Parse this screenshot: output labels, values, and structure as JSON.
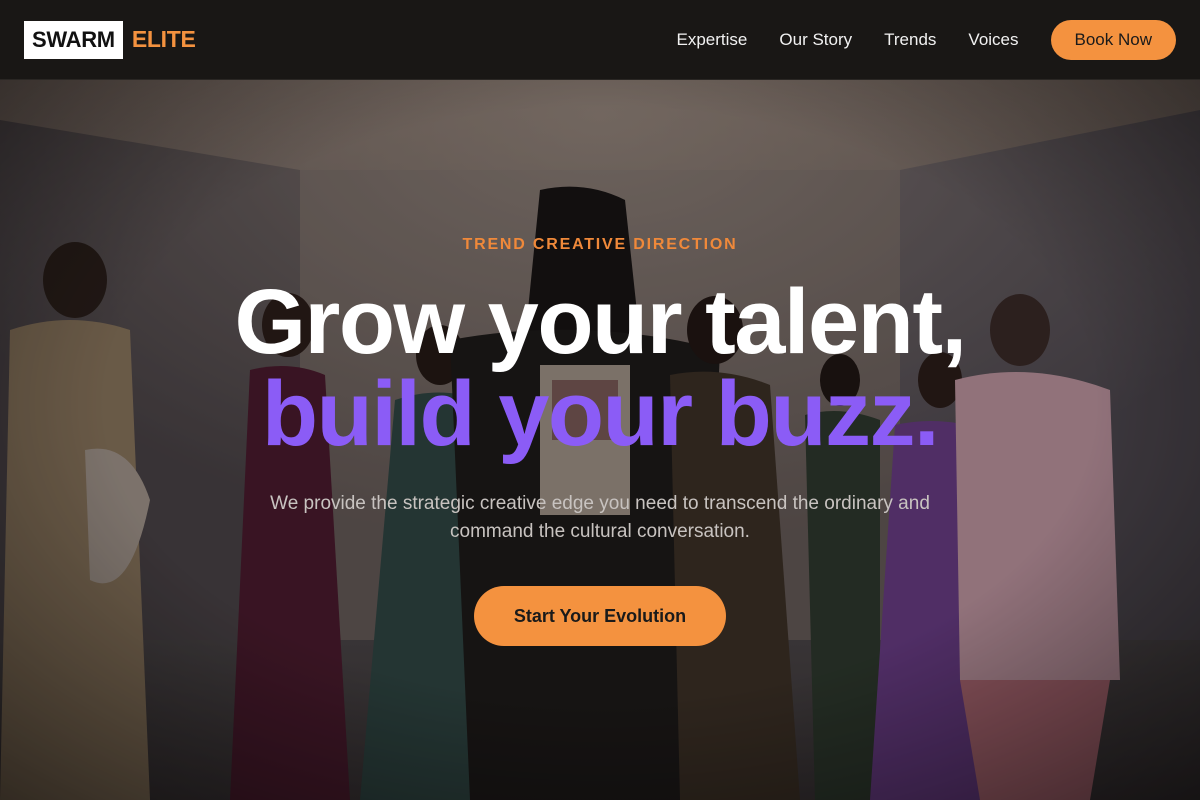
{
  "brand": {
    "logo_box": "SWARM",
    "logo_text": "ELITE"
  },
  "nav": {
    "items": [
      {
        "label": "Expertise"
      },
      {
        "label": "Our Story"
      },
      {
        "label": "Trends"
      },
      {
        "label": "Voices"
      }
    ],
    "cta_label": "Book Now"
  },
  "hero": {
    "eyebrow": "TREND CREATIVE DIRECTION",
    "headline_line1": "Grow your talent,",
    "headline_line2": "build your buzz.",
    "subtext": "We provide the strategic creative edge you need to transcend the ordinary and command the cultural conversation.",
    "cta_label": "Start Your Evolution",
    "background_image": "fashion-event-crowd-photo"
  },
  "colors": {
    "accent_orange": "#f4923f",
    "accent_purple": "#8b5cf6",
    "header_bg": "#191715"
  }
}
